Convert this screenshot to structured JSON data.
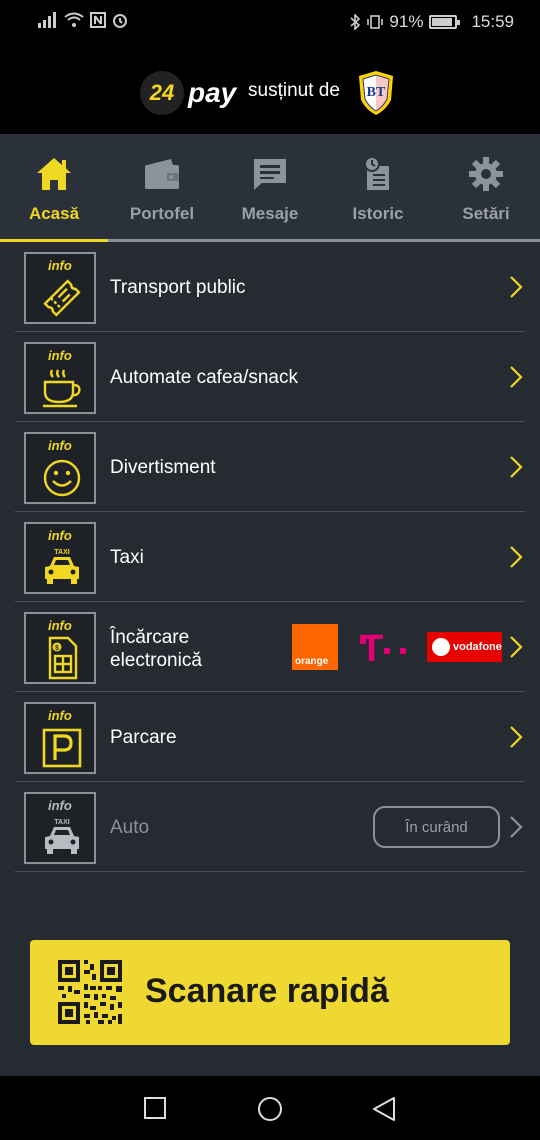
{
  "status_bar": {
    "battery": "91%",
    "battery_level": 0.91,
    "time": "15:59"
  },
  "brand": {
    "logo_number": "24",
    "logo_word": "pay",
    "supported_by": "susținut de",
    "partner_logo_text": "BT"
  },
  "nav": {
    "tabs": [
      {
        "label": "Acasă",
        "icon": "home-icon",
        "active": true
      },
      {
        "label": "Portofel",
        "icon": "wallet-icon",
        "active": false
      },
      {
        "label": "Mesaje",
        "icon": "message-icon",
        "active": false
      },
      {
        "label": "Istoric",
        "icon": "history-icon",
        "active": false
      },
      {
        "label": "Setări",
        "icon": "gear-icon",
        "active": false
      }
    ]
  },
  "services": {
    "info_tag": "info",
    "items": [
      {
        "label": "Transport public",
        "icon": "ticket-icon"
      },
      {
        "label": "Automate cafea/snack",
        "icon": "coffee-cup-icon"
      },
      {
        "label": "Divertisment",
        "icon": "smiley-icon"
      },
      {
        "label": "Taxi",
        "icon": "taxi-icon"
      },
      {
        "label_line1": "Încărcare",
        "label_line2": "electronică",
        "icon": "sim-card-icon"
      },
      {
        "label": "Parcare",
        "icon": "parking-icon"
      },
      {
        "label": "Auto",
        "icon": "car-icon",
        "badge": "În curând"
      }
    ],
    "operators": {
      "orange": "orange",
      "telekom": "T",
      "vodafone": "vodafone"
    },
    "taxi_sign": "TAXI"
  },
  "scan": {
    "label": "Scanare rapidă"
  },
  "colors": {
    "accent": "#f0d722",
    "background": "#262b32",
    "nav_bg": "#2b313a",
    "scan_bg": "#efd831"
  }
}
